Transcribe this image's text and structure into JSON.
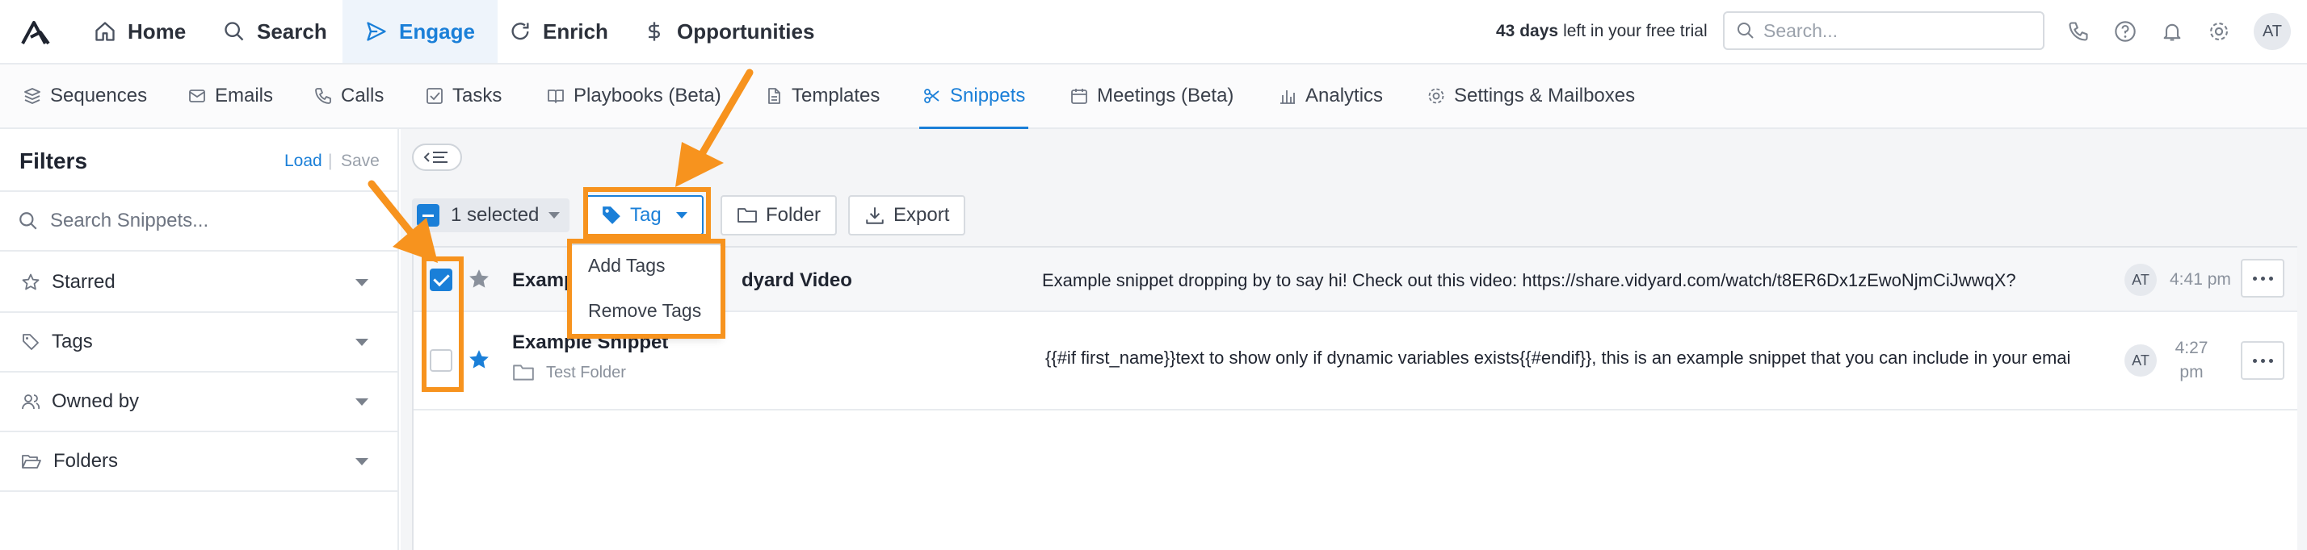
{
  "topnav": {
    "home": "Home",
    "search": "Search",
    "engage": "Engage",
    "enrich": "Enrich",
    "opportunities": "Opportunities",
    "trial_days": "43 days",
    "trial_rest": "left in your free trial",
    "search_placeholder": "Search...",
    "avatar": "AT"
  },
  "subnav": {
    "sequences": "Sequences",
    "emails": "Emails",
    "calls": "Calls",
    "tasks": "Tasks",
    "playbooks": "Playbooks (Beta)",
    "templates": "Templates",
    "snippets": "Snippets",
    "meetings": "Meetings (Beta)",
    "analytics": "Analytics",
    "settings": "Settings & Mailboxes"
  },
  "sidebar": {
    "title": "Filters",
    "load": "Load",
    "separator": "|",
    "save": "Save",
    "search_placeholder": "Search Snippets...",
    "facets": [
      "Starred",
      "Tags",
      "Owned by",
      "Folders"
    ]
  },
  "toolbar": {
    "selected": "1 selected",
    "tag": "Tag",
    "folder": "Folder",
    "export": "Export"
  },
  "dropdown": {
    "items": [
      "Add Tags",
      "Remove Tags"
    ]
  },
  "rows": [
    {
      "name_left": "Examp",
      "name_right": "dyard Video",
      "body": "Example snippet dropping by to say hi! Check out this video: https://share.vidyard.com/watch/t8ER6Dx1zEwoNjmCiJwwqX?",
      "owner": "AT",
      "time": "4:41 pm",
      "checked": true,
      "starred": false
    },
    {
      "name": "Example Snippet",
      "folder": "Test Folder",
      "body": "{{#if first_name}}text to show only if dynamic variables exists{{#endif}}, this is an example snippet that you can include in your emai",
      "owner": "AT",
      "time_line1": "4:27",
      "time_line2": "pm",
      "checked": false,
      "starred": true
    }
  ],
  "colors": {
    "accent": "#1a7fd8",
    "highlight": "#f7931e",
    "star_active": "#1a7fd8",
    "star_inactive": "#8a919c"
  }
}
